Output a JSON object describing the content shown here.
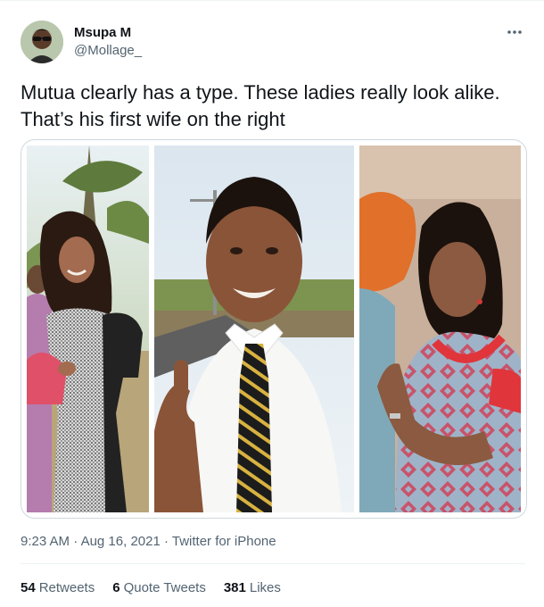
{
  "author": {
    "display_name": "Msupa M",
    "handle": "@Mollage_"
  },
  "tweet": {
    "text_line1": "Mutua clearly has a type. These ladies really look alike.",
    "text_line2": "That’s his first wife on the right"
  },
  "media": {
    "photos": [
      {
        "name": "woman-in-houndstooth-dress-photo"
      },
      {
        "name": "man-with-striped-tie-photo"
      },
      {
        "name": "woman-in-patterned-dress-photo"
      }
    ]
  },
  "meta": {
    "time": "9:23 AM",
    "separator": " · ",
    "date": "Aug 16, 2021",
    "source": "Twitter for iPhone"
  },
  "stats": {
    "retweets_count": "54",
    "retweets_label": "Retweets",
    "quotes_count": "6",
    "quotes_label": "Quote Tweets",
    "likes_count": "381",
    "likes_label": "Likes"
  },
  "icons": {
    "more": "more-options-icon"
  },
  "colors": {
    "text_primary": "#0f1419",
    "text_secondary": "#536471",
    "divider": "#eff3f4",
    "media_border": "#cfd9de"
  }
}
